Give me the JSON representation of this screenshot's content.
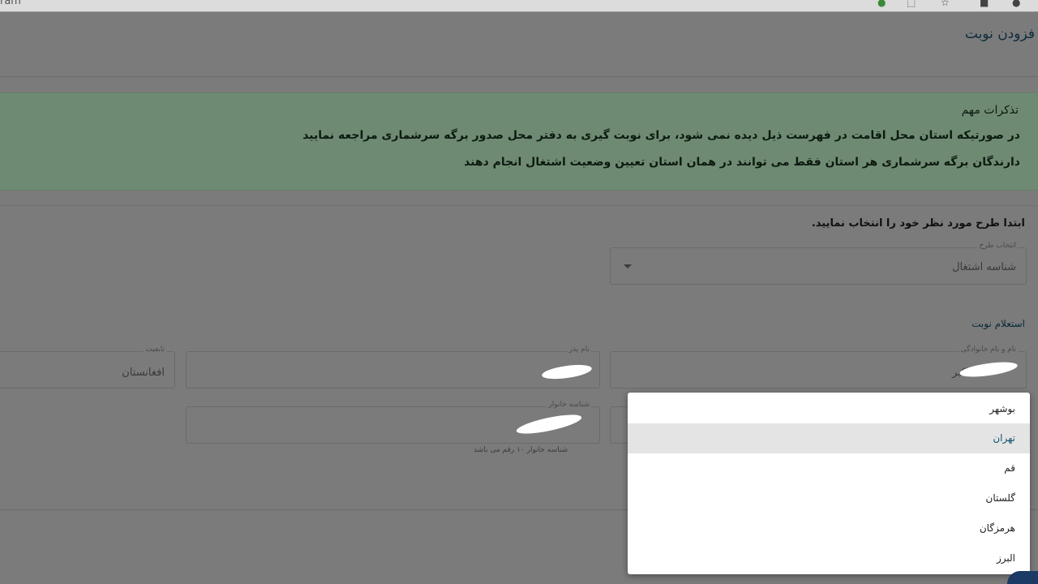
{
  "browser": {
    "url_fragment": "ram",
    "icons": [
      "g-badge-icon",
      "share-icon",
      "star-icon",
      "extension-icon",
      "profile-icon"
    ]
  },
  "page": {
    "title": "فزودن نوبت"
  },
  "alert": {
    "title": "تذکرات مهم",
    "line1": "در صورتیکه استان محل اقامت در فهرست ذیل دیده نمی شود، برای نوبت گیری به دفتر محل صدور برگه سرشماری مراجعه نمایید",
    "line2": "دارندگان برگه سرشماری هر استان فقط می توانند در همان استان تعیین وضعیت اشتغال انجام دهند",
    "color": "#6f8a73"
  },
  "plan": {
    "instruction": "ابتدا طرح مورد نظر خود را انتخاب نمایید.",
    "select_label": "انتخاب طرح",
    "select_value": "شناسه اشتغال"
  },
  "inquiry": {
    "section_title": "استعلام نوبت",
    "full_name_label": "نام و نام خانوادگی",
    "full_name_value": "اکبر",
    "father_name_label": "نام پدر",
    "father_name_value": "",
    "nationality_label": "تابعیت",
    "nationality_value": "افغانستان",
    "household_id_label": "شناسه خانوار",
    "household_id_value": "",
    "household_hint": "شناسه خانوار ۱۰ رقم می باشد"
  },
  "province_dropdown": {
    "options": [
      "بوشهر",
      "تهران",
      "قم",
      "گلستان",
      "هرمزگان",
      "البرز"
    ],
    "selected_index": 1
  }
}
